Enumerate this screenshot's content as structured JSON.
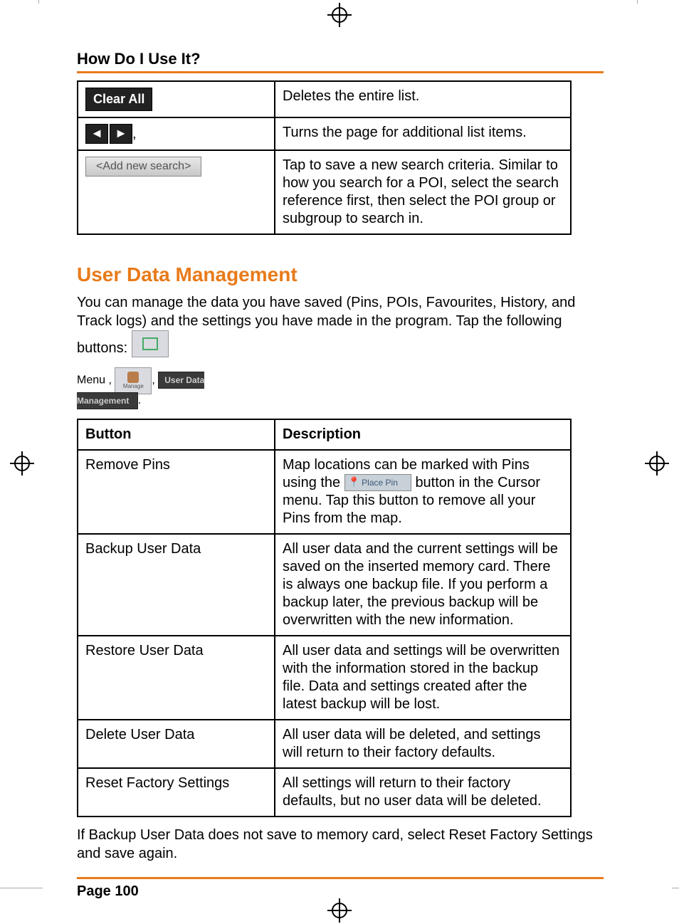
{
  "header": "How Do I Use It?",
  "table1": {
    "rows": [
      {
        "icon": "clear-all",
        "icon_label": "Clear All",
        "desc": "Deletes the entire list."
      },
      {
        "icon": "page-arrows",
        "icon_label": ",",
        "desc": "Turns the page for additional list items."
      },
      {
        "icon": "add-new-search",
        "icon_label": "<Add new search>",
        "desc": "Tap to save a new search criteria. Similar to how you search for a POI, select the search reference first, then select the POI group or subgroup to search in."
      }
    ]
  },
  "section_title": "User Data Management",
  "intro_text_1": "You can manage the data you have saved (Pins, POIs, Favourites, History, and Track logs) and the settings you have made in the program. Tap the following buttons: ",
  "inline_buttons": {
    "menu": "Menu",
    "manage": "Manage",
    "udm_line1": "User Data",
    "udm_line2": "Management"
  },
  "table2": {
    "headers": {
      "c1": "Button",
      "c2": "Description"
    },
    "rows": [
      {
        "button": "Remove Pins",
        "desc_pre": "Map locations can be marked with Pins using the ",
        "placepin_label": "Place Pin",
        "desc_post": " button in the Cursor menu. Tap this button to remove all your Pins from the map."
      },
      {
        "button": "Backup User Data",
        "desc": "All user data and the current settings will be saved on the inserted memory card. There is always one backup file. If you perform a backup later, the previous backup will be overwritten with the new information."
      },
      {
        "button": "Restore User Data",
        "desc": "All user data and settings will be overwritten with the information stored in the backup file. Data and settings created after the latest backup will be lost."
      },
      {
        "button": "Delete User Data",
        "desc": "All user data will be deleted, and settings will return to their factory defaults."
      },
      {
        "button": "Reset Factory Settings",
        "desc": "All settings will return to their factory defaults, but no user data will be deleted."
      }
    ]
  },
  "footer_note": "If Backup User Data does not save to memory card, select Reset Factory Settings and save again.",
  "page_number": "Page 100"
}
